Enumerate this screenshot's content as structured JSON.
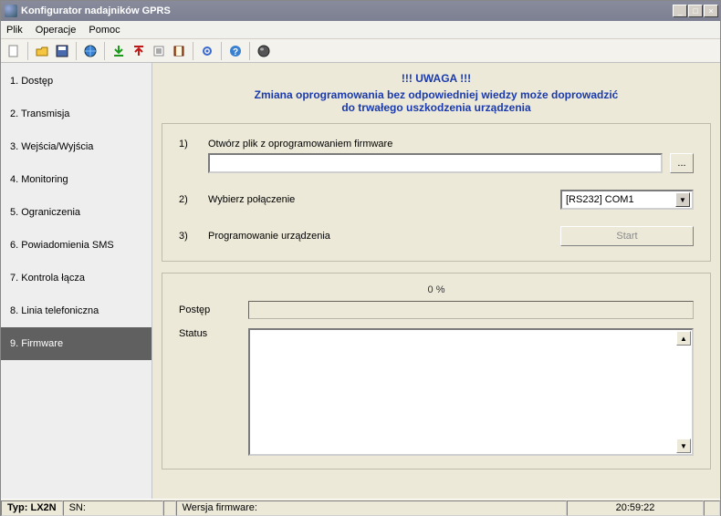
{
  "window": {
    "title": "Konfigurator nadajników GPRS"
  },
  "menu": {
    "file": "Plik",
    "operations": "Operacje",
    "help": "Pomoc"
  },
  "sidebar": {
    "items": [
      {
        "label": "1. Dostęp"
      },
      {
        "label": "2. Transmisja"
      },
      {
        "label": "3. Wejścia/Wyjścia"
      },
      {
        "label": "4. Monitoring"
      },
      {
        "label": "5. Ograniczenia"
      },
      {
        "label": "6. Powiadomienia SMS"
      },
      {
        "label": "7. Kontrola łącza"
      },
      {
        "label": "8. Linia telefoniczna"
      },
      {
        "label": "9. Firmware"
      }
    ],
    "active_index": 8
  },
  "warning": {
    "line0": "!!! UWAGA !!!",
    "line1": "Zmiana oprogramowania bez odpowiedniej wiedzy może doprowadzić",
    "line2": "do trwałego uszkodzenia urządzenia"
  },
  "steps": {
    "s1_num": "1)",
    "s1_label": "Otwórz plik z oprogramowaniem firmware",
    "s1_value": "",
    "browse_label": "...",
    "s2_num": "2)",
    "s2_label": "Wybierz połączenie",
    "s2_combo_selected": "[RS232] COM1",
    "s3_num": "3)",
    "s3_label": "Programowanie urządzenia",
    "start_label": "Start"
  },
  "progress": {
    "percent": "0 %",
    "label": "Postęp",
    "status_label": "Status",
    "status_value": ""
  },
  "status": {
    "type_label": "Typ:",
    "type_value": "LX2N",
    "sn_label": "SN:",
    "sn_value": "",
    "fw_label": "Wersja firmware:",
    "fw_value": "",
    "time": "20:59:22"
  },
  "icons": {
    "new": "new-icon",
    "open": "open-icon",
    "save": "save-icon",
    "globe": "globe-icon",
    "down": "download-icon",
    "up": "upload-icon",
    "log": "log-icon",
    "book": "book-icon",
    "gear": "gear-icon",
    "help": "help-icon",
    "sphere": "sphere-icon"
  }
}
